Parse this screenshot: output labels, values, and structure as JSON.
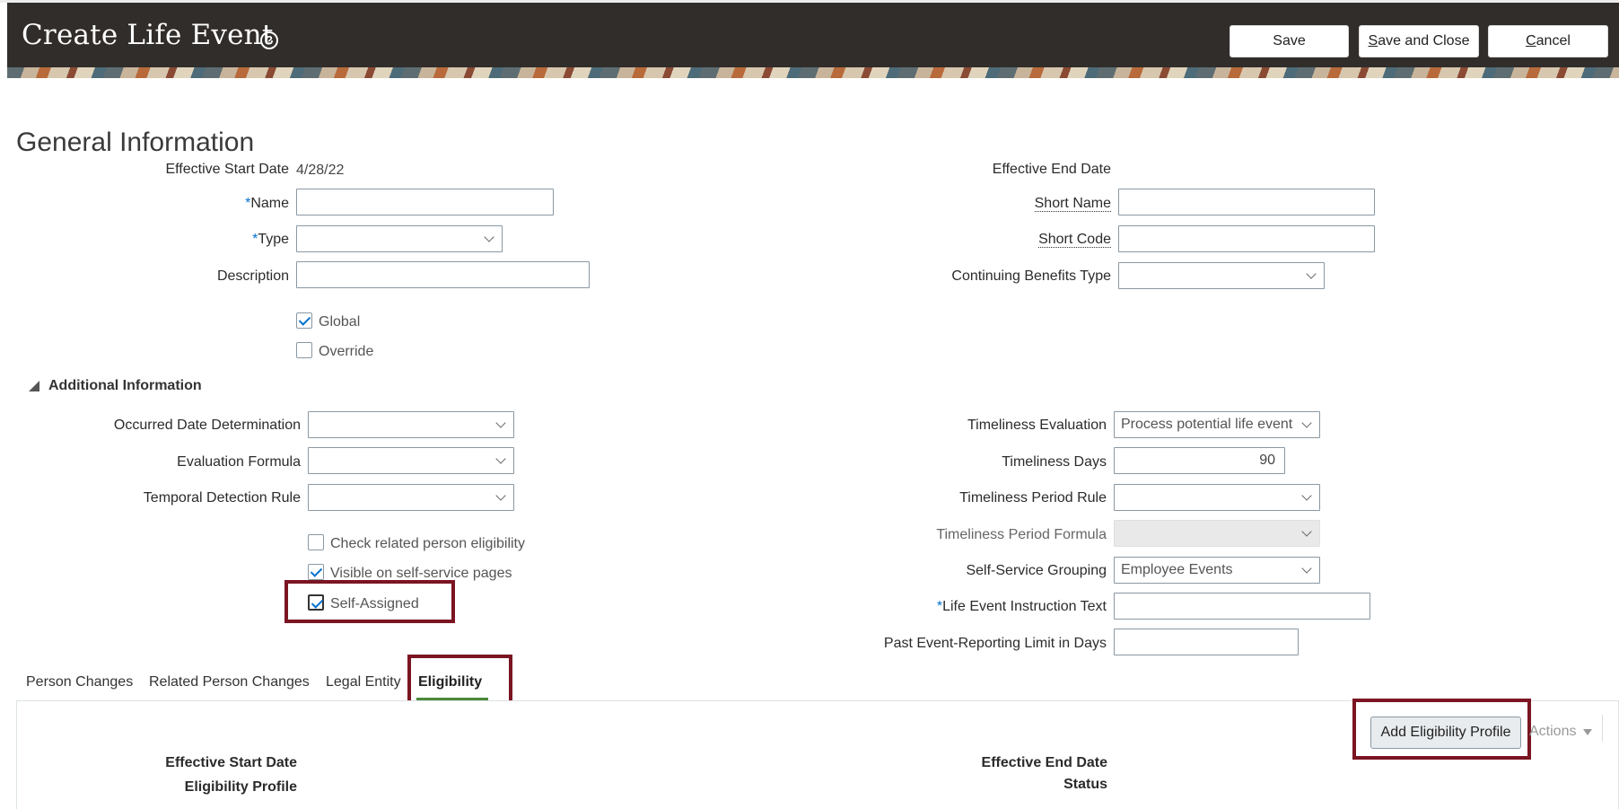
{
  "header": {
    "title": "Create Life Event",
    "help_icon": "help-circle-icon",
    "buttons": {
      "save": "Save",
      "save_and_close": "Save and Close",
      "cancel": "Cancel"
    }
  },
  "general": {
    "section_title": "General Information",
    "effective_start_date_label": "Effective Start Date",
    "effective_start_date_value": "4/28/22",
    "effective_end_date_label": "Effective End Date",
    "name_label": "Name",
    "name_value": "",
    "type_label": "Type",
    "type_value": "",
    "description_label": "Description",
    "description_value": "",
    "short_name_label": "Short Name",
    "short_code_label": "Short Code",
    "continuing_benefits_type_label": "Continuing Benefits Type",
    "continuing_benefits_type_value": "",
    "global_label": "Global",
    "global_checked": true,
    "override_label": "Override",
    "override_checked": false,
    "required_marker": "*"
  },
  "additional": {
    "title": "Additional Information",
    "occurred_date_determination_label": "Occurred Date Determination",
    "evaluation_formula_label": "Evaluation Formula",
    "temporal_detection_rule_label": "Temporal Detection Rule",
    "check_related_label": "Check related person eligibility",
    "check_related_checked": false,
    "visible_self_service_label": "Visible on self-service pages",
    "visible_self_service_checked": true,
    "self_assigned_label": "Self-Assigned",
    "self_assigned_checked": true,
    "timeliness_evaluation_label": "Timeliness Evaluation",
    "timeliness_evaluation_value": "Process potential life event",
    "timeliness_days_label": "Timeliness Days",
    "timeliness_days_value": "90",
    "timeliness_period_rule_label": "Timeliness Period Rule",
    "timeliness_period_formula_label": "Timeliness Period Formula",
    "self_service_grouping_label": "Self-Service Grouping",
    "self_service_grouping_value": "Employee Events",
    "life_event_instruction_label": "Life Event Instruction Text",
    "past_event_limit_label": "Past Event-Reporting Limit in Days"
  },
  "tabs": [
    {
      "label": "Person Changes",
      "active": false
    },
    {
      "label": "Related Person Changes",
      "active": false
    },
    {
      "label": "Legal Entity",
      "active": false
    },
    {
      "label": "Eligibility",
      "active": true
    }
  ],
  "eligibility": {
    "add_button": "Add Eligibility Profile",
    "actions_label": "Actions",
    "effective_start_date_label": "Effective Start Date",
    "effective_end_date_label": "Effective End Date",
    "eligibility_profile_label": "Eligibility Profile",
    "status_label": "Status"
  },
  "colors": {
    "header_bg": "#312d2a",
    "highlight": "#7b1522",
    "required": "#0572ce",
    "active_tab_underline": "#4a8a3b"
  }
}
